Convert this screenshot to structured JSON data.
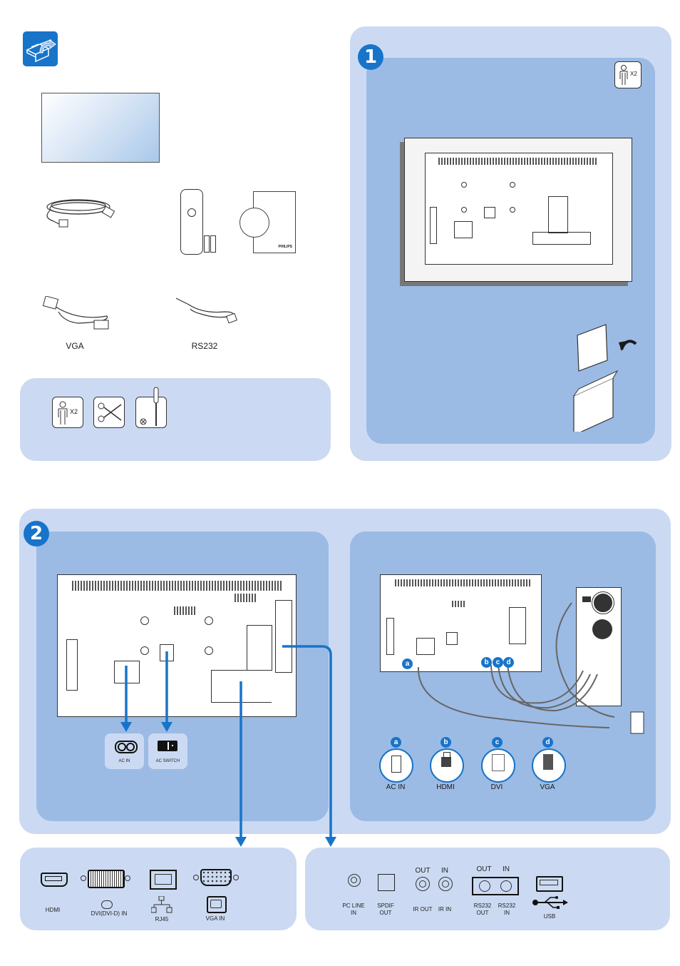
{
  "box_contents": {
    "icon": "unpack-box-icon",
    "items": [
      {
        "name": "display",
        "label": ""
      },
      {
        "name": "power-cord",
        "label": ""
      },
      {
        "name": "remote-control-with-batteries",
        "label": ""
      },
      {
        "name": "cd-rom-and-guide",
        "label": "",
        "brand": "PHILIPS"
      },
      {
        "name": "vga-cable",
        "label": "VGA"
      },
      {
        "name": "rs232-cable",
        "label": "RS232"
      }
    ],
    "tools": [
      {
        "icon": "two-persons-icon",
        "label": "X2"
      },
      {
        "icon": "scissors-icon",
        "label": ""
      },
      {
        "icon": "screwdriver-icon",
        "label": ""
      }
    ]
  },
  "step1": {
    "number": "1",
    "persons_label": "X2"
  },
  "step2": {
    "number": "2",
    "power_ports": [
      {
        "label": "AC IN",
        "icon": "ac-in-icon"
      },
      {
        "label": "AC SWITCH",
        "icon": "ac-switch-icon"
      }
    ],
    "connection_letters": [
      "a",
      "b",
      "c",
      "d"
    ],
    "connectors": [
      {
        "letter": "a",
        "label": "AC IN"
      },
      {
        "letter": "b",
        "label": "HDMI"
      },
      {
        "letter": "c",
        "label": "DVI"
      },
      {
        "letter": "d",
        "label": "VGA"
      }
    ],
    "input_ports": [
      {
        "label": "HDMI",
        "icon": "hdmi-port-icon"
      },
      {
        "label": "DVI(DVI-D) IN",
        "icon": "dvi-port-icon"
      },
      {
        "label": "RJ45",
        "icon": "rj45-port-icon"
      },
      {
        "label": "VGA IN",
        "icon": "vga-port-icon"
      }
    ],
    "io_ports": {
      "pc_line_in": "PC LINE\nIN",
      "spdif_out": "SPDIF\nOUT",
      "ir_out_top": "OUT",
      "ir_in_top": "IN",
      "ir_out": "IR OUT",
      "ir_in": "IR IN",
      "rs232_out_top": "OUT",
      "rs232_in_top": "IN",
      "rs232_out": "RS232\nOUT",
      "rs232_in": "RS232\nIN",
      "usb": "USB"
    }
  },
  "colors": {
    "accent": "#1874c9",
    "panel_light": "#cbdaf2",
    "panel_mid": "#9bbbe5"
  }
}
